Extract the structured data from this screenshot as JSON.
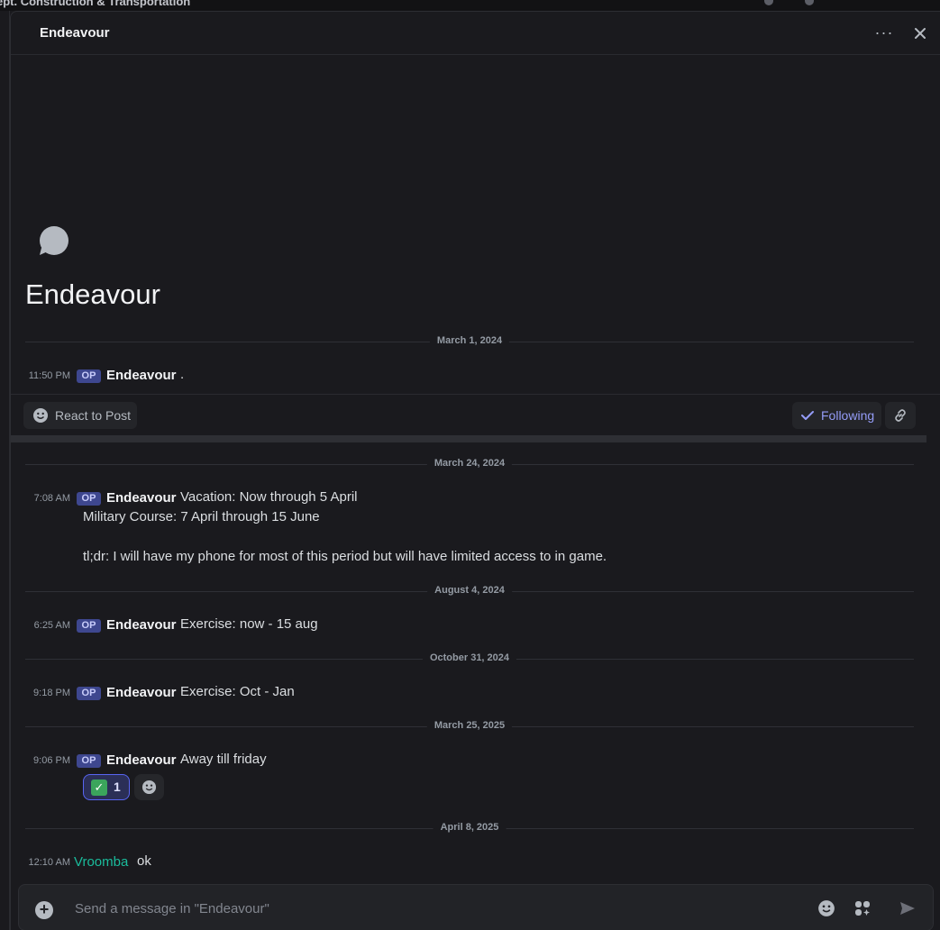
{
  "window": {
    "breadcrumb": "ept. Construction & Transportation"
  },
  "header": {
    "title": "Endeavour"
  },
  "post": {
    "title": "Endeavour",
    "react_label": "React to Post",
    "following_label": "Following"
  },
  "messages": [
    {
      "date": "March 1, 2024",
      "time": "11:50 PM",
      "op": "OP",
      "author": "Endeavour",
      "text": "."
    },
    {
      "date": "March 24, 2024",
      "time": "7:08 AM",
      "op": "OP",
      "author": "Endeavour",
      "text": "Vacation: Now through 5 April",
      "lines": [
        "Military Course: 7 April through 15 June",
        "",
        "tl;dr: I will have my phone for most of this period but will have limited access to in game."
      ]
    },
    {
      "date": "August 4, 2024",
      "time": "6:25 AM",
      "op": "OP",
      "author": "Endeavour",
      "text": "Exercise: now - 15 aug"
    },
    {
      "date": "October 31, 2024",
      "time": "9:18 PM",
      "op": "OP",
      "author": "Endeavour",
      "text": "Exercise: Oct - Jan"
    },
    {
      "date": "March 25, 2025",
      "time": "9:06 PM",
      "op": "OP",
      "author": "Endeavour",
      "text": "Away till friday",
      "reaction": {
        "emoji": "✓",
        "count": "1"
      }
    },
    {
      "date": "April 8, 2025",
      "time": "12:10 AM",
      "author": "Vroomba",
      "author_color": "#1abc9c",
      "text": "ok"
    }
  ],
  "composer": {
    "placeholder": "Send a message in \"Endeavour\""
  },
  "colors": {
    "background": "#1a1a1e",
    "accent": "#5865f2",
    "following": "#949cf7",
    "vroomba": "#1abc9c"
  }
}
